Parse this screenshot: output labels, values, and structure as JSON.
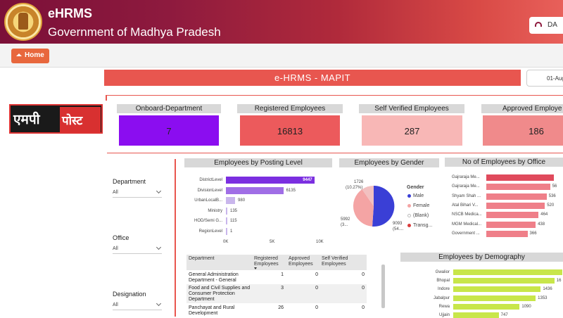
{
  "header": {
    "app_title": "eHRMS",
    "subtitle": "Government of Madhya Pradesh",
    "dashboard_btn": "DA"
  },
  "toolbar": {
    "home_label": "Home"
  },
  "banner": {
    "title": "e-HRMS - MAPIT",
    "date": "01-Aug-"
  },
  "logo": {
    "left_text": "एमपी",
    "right_text": "पोस्ट"
  },
  "cards": [
    {
      "title": "Onboard-Department",
      "value": "7",
      "color": "#8b0df0"
    },
    {
      "title": "Registered Employees",
      "value": "16813",
      "color": "#ec5a5c"
    },
    {
      "title": "Self Verified Employees",
      "value": "287",
      "color": "#f8b7b6"
    },
    {
      "title": "Approved Employe",
      "value": "186",
      "color": "#f08a8b"
    }
  ],
  "slicers": [
    {
      "label": "Department",
      "value": "All"
    },
    {
      "label": "Office",
      "value": "All"
    },
    {
      "label": "Designation",
      "value": "All"
    }
  ],
  "posting": {
    "title": "Employees by Posting Level",
    "rows": [
      {
        "label": "DistrictLevel",
        "value": 9447,
        "display": "9447"
      },
      {
        "label": "DivisionLevel",
        "value": 6135,
        "display": "6135"
      },
      {
        "label": "UrbanLocalB...",
        "value": 980,
        "display": "980"
      },
      {
        "label": "Ministry",
        "value": 135,
        "display": "135"
      },
      {
        "label": "HOD/Semi G...",
        "value": 115,
        "display": "115"
      },
      {
        "label": "RegionLevel",
        "value": 1,
        "display": "1"
      }
    ],
    "ticks": [
      "0K",
      "5K",
      "10K"
    ],
    "max": 10000
  },
  "gender": {
    "title": "Employees by Gender",
    "label_top_1": "1726",
    "label_top_2": "(10.27%)",
    "label_left_1": "5992",
    "label_left_2": "(3...",
    "label_right_1": "9093",
    "label_right_2": "(54....",
    "legend_title": "Gender",
    "legend": [
      {
        "name": "Male",
        "color": "#3a3fd6"
      },
      {
        "name": "Female",
        "color": "#f4a4a4"
      },
      {
        "name": "(Blank)",
        "color": "#ffffff"
      },
      {
        "name": "Transg...",
        "color": "#d93c3c"
      }
    ]
  },
  "office": {
    "title": "No of Employees by Office",
    "rows": [
      {
        "label": "Gajraraja Me...",
        "value": 600,
        "display": ""
      },
      {
        "label": "Gajraraja Me...",
        "value": 567,
        "display": "56"
      },
      {
        "label": "Shyam Shah ...",
        "value": 536,
        "display": "536"
      },
      {
        "label": "Atal Bihari V...",
        "value": 520,
        "display": "520"
      },
      {
        "label": "NSCB Medica...",
        "value": 464,
        "display": "464"
      },
      {
        "label": "MGM Medical...",
        "value": 438,
        "display": "438"
      },
      {
        "label": "Government ...",
        "value": 366,
        "display": "366"
      }
    ],
    "max": 600
  },
  "table": {
    "headers": [
      "Department",
      "Registered Employees",
      "Approved Employees",
      "Self Verified Employees"
    ],
    "rows": [
      {
        "dept": "General Administration Department - General",
        "reg": "1",
        "appr": "0",
        "self": "0"
      },
      {
        "dept": "Food and Civil Supplies and Consumer Protection Department",
        "reg": "3",
        "appr": "0",
        "self": "0"
      },
      {
        "dept": "Panchayat and Rural Development",
        "reg": "26",
        "appr": "0",
        "self": "0"
      }
    ]
  },
  "demography": {
    "title": "Employees by Demography",
    "rows": [
      {
        "label": "Gwalior",
        "value": 1790,
        "display": "179"
      },
      {
        "label": "Bhopal",
        "value": 1660,
        "display": "16"
      },
      {
        "label": "Indore",
        "value": 1436,
        "display": "1436"
      },
      {
        "label": "Jabalpur",
        "value": 1353,
        "display": "1353"
      },
      {
        "label": "Rewa",
        "value": 1090,
        "display": "1090"
      },
      {
        "label": "Ujjain",
        "value": 747,
        "display": "747"
      }
    ],
    "max": 1790
  }
}
